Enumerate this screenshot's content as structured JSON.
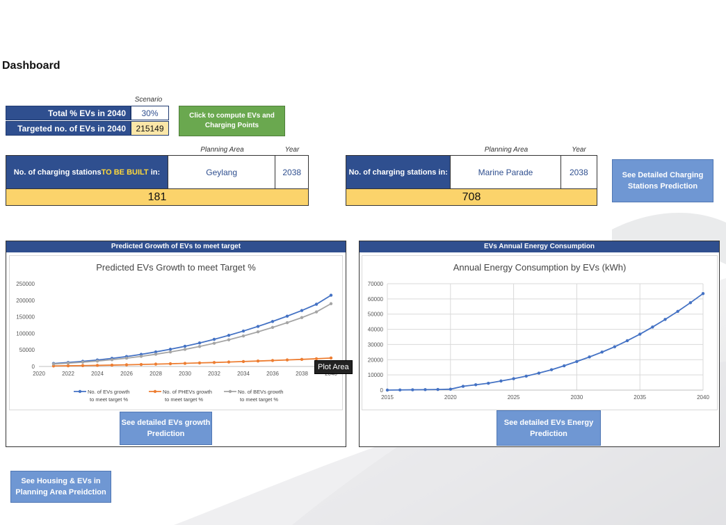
{
  "page": {
    "title": "Dashboard"
  },
  "scenario": {
    "header": "Scenario",
    "total_label": "Total % EVs in 2040",
    "total_value": "30%",
    "target_label": "Targeted no. of EVs in 2040",
    "target_value": "215149"
  },
  "compute_button": {
    "label": "Click to compute EVs and Charging Points"
  },
  "build_box": {
    "col_area": "Planning Area",
    "col_year": "Year",
    "label_prefix": "No. of charging stations ",
    "label_highlight": "TO BE BUILT",
    "label_suffix": " in:",
    "area": "Geylang",
    "year": "2038",
    "result": "181"
  },
  "existing_box": {
    "col_area": "Planning Area",
    "col_year": "Year",
    "label": "No. of charging stations in:",
    "area": "Marine Parade",
    "year": "2038",
    "result": "708"
  },
  "buttons": {
    "charging_detail": "See Detailed Charging Stations Prediction",
    "ev_growth_detail": "See detailed EVs growth Prediction",
    "energy_detail": "See detailed EVs Energy Prediction",
    "housing_detail": "See Housing & EVs in Planning Area Preidction"
  },
  "tooltip": "Plot Area",
  "colors": {
    "navy": "#2f4f8f",
    "yellow": "#fbd36b",
    "green": "#6aa84f",
    "button_blue": "#6f97d3",
    "series_blue": "#4472c4",
    "series_orange": "#ed7d31",
    "series_gray": "#a5a5a5"
  },
  "chart_data": [
    {
      "panel_title": "Predicted Growth of EVs to meet target",
      "type": "line",
      "title": "Predicted EVs Growth to meet Target %",
      "xlim": [
        2020,
        2040
      ],
      "ylim": [
        0,
        250000
      ],
      "x_ticks": [
        2020,
        2022,
        2024,
        2026,
        2028,
        2030,
        2032,
        2034,
        2036,
        2038,
        2040
      ],
      "y_ticks": [
        0,
        50000,
        100000,
        150000,
        200000,
        250000
      ],
      "grid": false,
      "legend": "bottom",
      "x": [
        2021,
        2022,
        2023,
        2024,
        2025,
        2026,
        2027,
        2028,
        2029,
        2030,
        2031,
        2032,
        2033,
        2034,
        2035,
        2036,
        2037,
        2038,
        2039,
        2040
      ],
      "series": [
        {
          "name": "No. of EVs growth to meet target %",
          "color": "#4472c4",
          "values": [
            9000,
            12000,
            15500,
            19500,
            24500,
            30000,
            36500,
            44000,
            52000,
            61000,
            71000,
            82000,
            94000,
            107000,
            121000,
            136000,
            152000,
            169000,
            188000,
            215149
          ]
        },
        {
          "name": "No. of PHEVs growth to meet target %",
          "color": "#ed7d31",
          "values": [
            1500,
            2000,
            2600,
            3300,
            4100,
            5000,
            6000,
            7100,
            8200,
            9400,
            10700,
            12000,
            13400,
            14900,
            16400,
            18000,
            19700,
            21400,
            23200,
            25500
          ]
        },
        {
          "name": "No. of BEVs growth to meet target %",
          "color": "#a5a5a5",
          "values": [
            7500,
            10000,
            12900,
            16200,
            20400,
            25000,
            30500,
            36900,
            43800,
            51600,
            60300,
            70000,
            80600,
            92100,
            104600,
            118000,
            132300,
            147600,
            164800,
            189600
          ]
        }
      ]
    },
    {
      "panel_title": "EVs Annual Energy Consumption",
      "type": "line",
      "title": "Annual Energy Consumption by EVs (kWh)",
      "xlim": [
        2015,
        2040
      ],
      "ylim": [
        0,
        70000
      ],
      "x_ticks": [
        2015,
        2020,
        2025,
        2030,
        2035,
        2040
      ],
      "y_ticks": [
        0,
        10000,
        20000,
        30000,
        40000,
        50000,
        60000,
        70000
      ],
      "grid": true,
      "x": [
        2015,
        2016,
        2017,
        2018,
        2019,
        2020,
        2021,
        2022,
        2023,
        2024,
        2025,
        2026,
        2027,
        2028,
        2029,
        2030,
        2031,
        2032,
        2033,
        2034,
        2035,
        2036,
        2037,
        2038,
        2039,
        2040
      ],
      "series": [
        {
          "color": "#4472c4",
          "values": [
            0,
            100,
            200,
            300,
            400,
            600,
            2500,
            3500,
            4500,
            6000,
            7500,
            9200,
            11200,
            13400,
            16000,
            18800,
            21800,
            25000,
            28500,
            32500,
            36800,
            41500,
            46500,
            51800,
            57500,
            63500
          ]
        }
      ]
    }
  ]
}
